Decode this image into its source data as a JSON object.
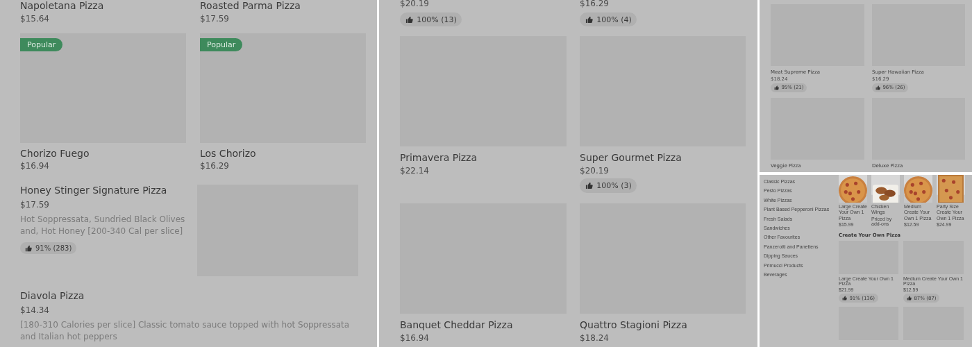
{
  "panel_1": {
    "top_items": [
      {
        "name": "Napoletana Pizza",
        "price": "$15.64"
      },
      {
        "name": "Roasted Parma Pizza",
        "price": "$17.59"
      }
    ],
    "cards": [
      {
        "name": "Chorizo Fuego",
        "price": "$16.94",
        "badge": "Popular"
      },
      {
        "name": "Los Chorizo",
        "price": "$16.29",
        "badge": "Popular"
      }
    ],
    "list_items": [
      {
        "kind": "image_row",
        "name": "Honey Stinger Signature Pizza",
        "price": "$17.59",
        "description": "Hot Soppressata, Sundried Black Olives and, Hot Honey [200-340 Cal per slice]",
        "rating": "91% (283)"
      },
      {
        "kind": "text_row",
        "name": "Diavola Pizza",
        "price": "$14.34",
        "description": "[180-310 Calories per slice] Classic tomato sauce topped with hot Soppressata and Italian hot peppers"
      }
    ]
  },
  "panel_2": {
    "top_items": [
      {
        "price": "$20.19",
        "rating": "100% (13)"
      },
      {
        "price": "$16.29",
        "rating": "100% (4)"
      }
    ],
    "cards": [
      {
        "name": "Primavera Pizza",
        "price": "$22.14"
      },
      {
        "name": "Super Gourmet Pizza",
        "price": "$20.19",
        "rating": "100% (3)"
      },
      {
        "name": "Banquet Cheddar Pizza",
        "price": "$16.94"
      },
      {
        "name": "Quattro Stagioni Pizza",
        "price": "$18.24"
      }
    ]
  },
  "panel_3": {
    "cards": [
      {
        "name": "Meat Supreme Pizza",
        "price": "$18.24",
        "rating": "95% (21)"
      },
      {
        "name": "Super Hawaiian Pizza",
        "price": "$16.29",
        "rating": "96% (26)"
      },
      {
        "name": "Veggie Pizza"
      },
      {
        "name": "Deluxe Pizza"
      }
    ]
  },
  "panel_4": {
    "categories": [
      "Classic Pizzas",
      "Pesto Pizzas",
      "White Pizzas",
      "Plant Based Pepperoni Pizzas",
      "Fresh Salads",
      "Sandwiches",
      "Other Favourites",
      "Panzerotti and Panettens",
      "Dipping Sauces",
      "Primucci Products",
      "Beverages"
    ],
    "carousel": [
      {
        "name": "Large Create Your Own 1 Pizza",
        "price": "$15.99"
      },
      {
        "name": "Chicken Wings",
        "note": "Priced by add-ons"
      },
      {
        "name": "Medium Create Your Own 1 Pizza",
        "price": "$12.59"
      },
      {
        "name": "Party Size Create Your Own 1 Pizza",
        "price": "$24.99"
      }
    ],
    "section_title": "Create Your Own Pizza",
    "cards": [
      {
        "kind": "item",
        "name": "Large Create Your Own 1 Pizza",
        "price": "$21.99",
        "rating": "91% (136)"
      },
      {
        "kind": "item",
        "name": "Medium Create Your Own 1 Pizza",
        "price": "$12.59",
        "rating": "87% (87)"
      },
      {
        "kind": "image_only"
      },
      {
        "kind": "image_only"
      }
    ]
  }
}
